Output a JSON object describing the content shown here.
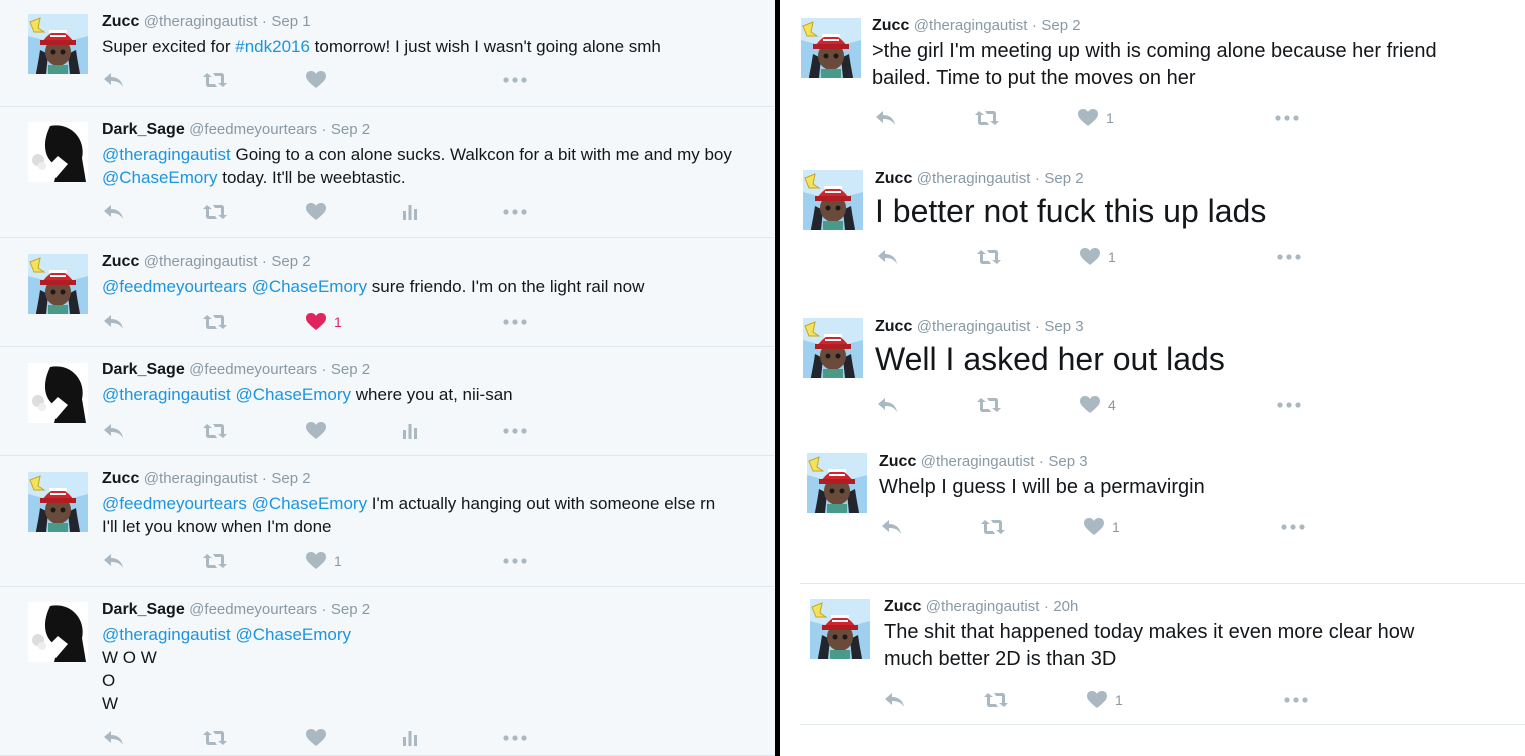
{
  "left_tweets": [
    {
      "name": "Zucc",
      "handle": "@theragingautist",
      "dot": "·",
      "time": "Sep 1",
      "segments": [
        {
          "t": "Super excited for "
        },
        {
          "t": "#ndk2016",
          "link": true
        },
        {
          "t": " tomorrow! I just wish I wasn't going alone smh"
        }
      ],
      "likes": "",
      "liked": false,
      "analytics": false,
      "avatar": "zucc"
    },
    {
      "name": "Dark_Sage",
      "handle": "@feedmeyourtears",
      "dot": "·",
      "time": "Sep 2",
      "segments": [
        {
          "t": "@theragingautist",
          "link": true
        },
        {
          "t": " Going to a con alone sucks. Walkcon for a bit with me and my boy "
        },
        {
          "t": "@ChaseEmory",
          "link": true
        },
        {
          "t": " today. It'll be weebtastic."
        }
      ],
      "likes": "",
      "liked": false,
      "analytics": true,
      "avatar": "sage"
    },
    {
      "name": "Zucc",
      "handle": "@theragingautist",
      "dot": "·",
      "time": "Sep 2",
      "segments": [
        {
          "t": "@feedmeyourtears",
          "link": true
        },
        {
          "t": " "
        },
        {
          "t": "@ChaseEmory",
          "link": true
        },
        {
          "t": " sure friendo. I'm on the light rail now"
        }
      ],
      "likes": "1",
      "liked": true,
      "analytics": false,
      "avatar": "zucc"
    },
    {
      "name": "Dark_Sage",
      "handle": "@feedmeyourtears",
      "dot": "·",
      "time": "Sep 2",
      "segments": [
        {
          "t": "@theragingautist",
          "link": true
        },
        {
          "t": " "
        },
        {
          "t": "@ChaseEmory",
          "link": true
        },
        {
          "t": " where you at, nii-san"
        }
      ],
      "likes": "",
      "liked": false,
      "analytics": true,
      "avatar": "sage"
    },
    {
      "name": "Zucc",
      "handle": "@theragingautist",
      "dot": "·",
      "time": "Sep 2",
      "segments": [
        {
          "t": "@feedmeyourtears",
          "link": true
        },
        {
          "t": " "
        },
        {
          "t": "@ChaseEmory",
          "link": true
        },
        {
          "t": " I'm actually hanging out with someone else rn I'll let you know when I'm done"
        }
      ],
      "likes": "1",
      "liked": false,
      "analytics": false,
      "avatar": "zucc"
    },
    {
      "name": "Dark_Sage",
      "handle": "@feedmeyourtears",
      "dot": "·",
      "time": "Sep 2",
      "segments": [
        {
          "t": "@theragingautist",
          "link": true
        },
        {
          "t": " "
        },
        {
          "t": "@ChaseEmory",
          "link": true
        },
        {
          "t": "\nW O W\nO\nW"
        }
      ],
      "likes": "",
      "liked": false,
      "analytics": true,
      "avatar": "sage"
    }
  ],
  "right_tweets": [
    {
      "name": "Zucc",
      "handle": "@theragingautist",
      "dot": "·",
      "time": "Sep 2",
      "segments": [
        {
          "t": ">the girl I'm meeting up with is coming alone because her friend bailed. Time to put the moves on her"
        }
      ],
      "size": "med",
      "likes": "1",
      "liked": false,
      "analytics": false,
      "avatar": "zucc"
    },
    {
      "name": "Zucc",
      "handle": "@theragingautist",
      "dot": "·",
      "time": "Sep 2",
      "segments": [
        {
          "t": "I better not fuck this up lads"
        }
      ],
      "size": "big",
      "likes": "1",
      "liked": false,
      "analytics": false,
      "avatar": "zucc"
    },
    {
      "name": "Zucc",
      "handle": "@theragingautist",
      "dot": "·",
      "time": "Sep 3",
      "segments": [
        {
          "t": "Well I asked her out lads"
        }
      ],
      "size": "big",
      "likes": "4",
      "liked": false,
      "analytics": false,
      "avatar": "zucc"
    },
    {
      "name": "Zucc",
      "handle": "@theragingautist",
      "dot": "·",
      "time": "Sep 3",
      "segments": [
        {
          "t": "Whelp I guess I will be a permavirgin"
        }
      ],
      "size": "med",
      "likes": "1",
      "liked": false,
      "analytics": false,
      "avatar": "zucc"
    },
    {
      "name": "Zucc",
      "handle": "@theragingautist",
      "dot": "·",
      "time": "20h",
      "segments": [
        {
          "t": "The shit that happened today makes it even more clear how much better 2D is than 3D"
        }
      ],
      "size": "med",
      "likes": "1",
      "liked": false,
      "analytics": false,
      "avatar": "zucc"
    }
  ],
  "colors": {
    "link": "#1b95e0",
    "muted": "#8899a6",
    "like": "#e0245e",
    "icon": "#aab8c2"
  },
  "icons": [
    "reply-icon",
    "retweet-icon",
    "heart-icon",
    "analytics-icon",
    "more-icon"
  ]
}
